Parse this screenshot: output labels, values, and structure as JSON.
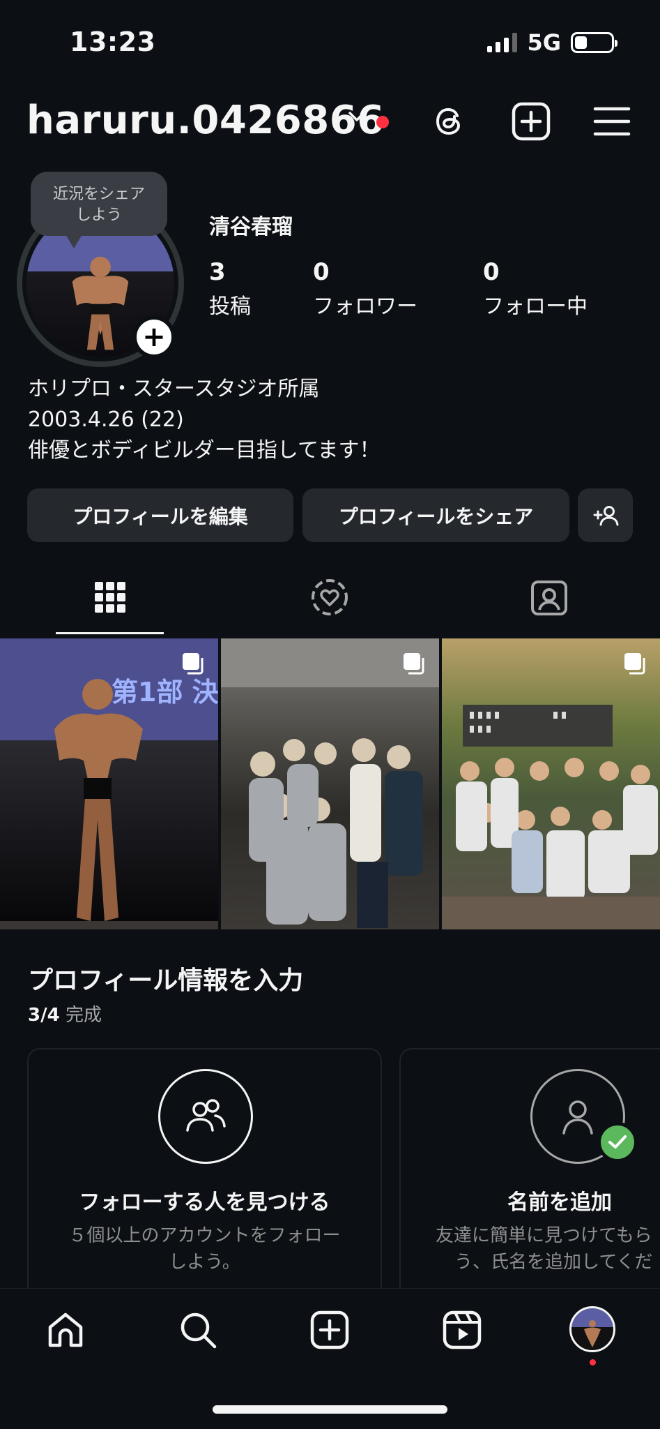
{
  "status_bar": {
    "time": "13:23",
    "network": "5G",
    "battery_level": 0.34
  },
  "header": {
    "username": "haruru.0426866"
  },
  "profile": {
    "note_bubble": [
      "近況をシェア",
      "しよう"
    ],
    "display_name": "清谷春瑠",
    "stats": [
      {
        "value": "3",
        "label": "投稿"
      },
      {
        "value": "0",
        "label": "フォロワー"
      },
      {
        "value": "0",
        "label": "フォロー中"
      }
    ],
    "bio": [
      "ホリプロ・スタースタジオ所属",
      "2003.4.26 (22)",
      "俳優とボディビルダー目指してます！"
    ]
  },
  "buttons": {
    "edit": "プロフィールを編集",
    "share": "プロフィールをシェア"
  },
  "profile_info": {
    "title": "プロフィール情報を入力",
    "progress_bold": "3/4",
    "progress_rest": " 完成",
    "cards": [
      {
        "title": "フォローする人を見つける",
        "desc": [
          "５個以上のアカウントをフォロー",
          "しよう。"
        ]
      },
      {
        "title": "名前を追加",
        "desc": [
          "友達に簡単に見つけてもら",
          "う、氏名を追加してくだ"
        ]
      }
    ]
  },
  "icons": {
    "header": [
      "chevron-down-icon",
      "threads-icon",
      "new-post-icon",
      "menu-icon"
    ],
    "tabs": [
      "grid-icon",
      "reels-icon",
      "tagged-icon"
    ],
    "nav": [
      "home-icon",
      "search-icon",
      "create-icon",
      "reels-icon",
      "profile-avatar"
    ]
  },
  "colors": {
    "background": "#0c1014",
    "notification": "#ff3040",
    "check": "#5cb85c",
    "button": "#25292e"
  }
}
